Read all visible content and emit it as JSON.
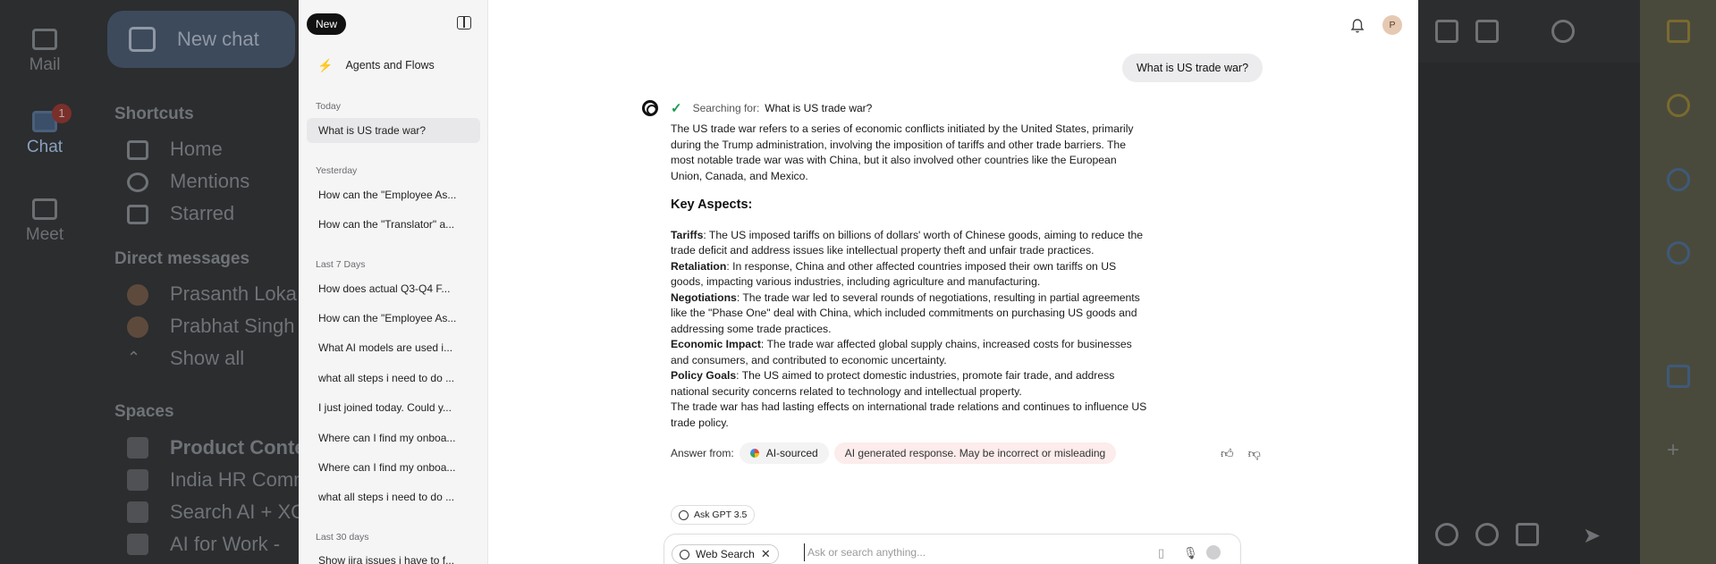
{
  "background": {
    "rail": [
      {
        "label": "Mail"
      },
      {
        "label": "Chat",
        "badge": "1"
      },
      {
        "label": "Meet"
      }
    ],
    "new_chat": "New chat",
    "shortcuts_header": "Shortcuts",
    "shortcuts": [
      "Home",
      "Mentions",
      "Starred"
    ],
    "dm_header": "Direct messages",
    "dms": [
      "Prasanth Loka",
      "Prabhat Singh",
      "Show all"
    ],
    "spaces_header": "Spaces",
    "spaces": [
      "Product Conte",
      "India HR Comm",
      "Search AI + XO",
      "AI for Work -"
    ]
  },
  "sidebar": {
    "new_label": "New",
    "agents_label": "Agents and Flows",
    "sections": [
      {
        "label": "Today",
        "items": [
          {
            "text": "What is US trade war?",
            "active": true
          }
        ]
      },
      {
        "label": "Yesterday",
        "items": [
          {
            "text": "How can the \"Employee As..."
          },
          {
            "text": "How can the \"Translator\" a..."
          }
        ]
      },
      {
        "label": "Last 7 Days",
        "items": [
          {
            "text": "How does actual Q3-Q4 F..."
          },
          {
            "text": "How can the \"Employee As..."
          },
          {
            "text": "What AI models are used i..."
          },
          {
            "text": "what all steps i need to do ..."
          },
          {
            "text": "I just joined today. Could y..."
          },
          {
            "text": "Where can I find my onboa..."
          },
          {
            "text": "Where can I find my onboa..."
          },
          {
            "text": "what all steps i need to do ..."
          }
        ]
      },
      {
        "label": "Last 30 days",
        "items": [
          {
            "text": "Show jira issues i have to f..."
          }
        ]
      }
    ]
  },
  "header": {
    "avatar_initial": "P"
  },
  "conversation": {
    "user_message": "What is US trade war?",
    "search_prefix": "Searching for:",
    "search_query": "What is US trade war?",
    "intro": "The US trade war refers to a series of economic conflicts initiated by the United States, primarily during the Trump administration, involving the imposition of tariffs and other trade barriers. The most notable trade war was with China, but it also involved other countries like the European Union, Canada, and Mexico.",
    "key_heading": "Key Aspects:",
    "aspects": [
      {
        "term": "Tariffs",
        "text": ": The US imposed tariffs on billions of dollars' worth of Chinese goods, aiming to reduce the trade deficit and address issues like intellectual property theft and unfair trade practices."
      },
      {
        "term": "Retaliation",
        "text": ": In response, China and other affected countries imposed their own tariffs on US goods, impacting various industries, including agriculture and manufacturing."
      },
      {
        "term": "Negotiations",
        "text": ": The trade war led to several rounds of negotiations, resulting in partial agreements like the \"Phase One\" deal with China, which included commitments on purchasing US goods and addressing some trade practices."
      },
      {
        "term": "Economic Impact",
        "text": ": The trade war affected global supply chains, increased costs for businesses and consumers, and contributed to economic uncertainty."
      },
      {
        "term": "Policy Goals",
        "text": ": The US aimed to protect domestic industries, promote fair trade, and address national security concerns related to technology and intellectual property."
      }
    ],
    "conclusion": "The trade war has had lasting effects on international trade relations and continues to influence US trade policy.",
    "answer_from_label": "Answer from:",
    "source_pill": "AI-sourced",
    "disclaimer": "AI generated response. May be incorrect or misleading"
  },
  "composer": {
    "model_label": "Ask GPT 3.5",
    "web_search_label": "Web Search",
    "placeholder": "Ask or search anything..."
  },
  "icons": {
    "thumbs_up": "thumbs-up-icon",
    "thumbs_down": "thumbs-down-icon",
    "bell": "bell-icon",
    "mic": "mic-icon",
    "attach": "attach-icon",
    "send": "send-icon"
  },
  "colors": {
    "accent_dark": "#111111",
    "check_green": "#1a9b53",
    "disclaimer_bg": "#fcecec",
    "dim_background": "#2b2d2f"
  }
}
